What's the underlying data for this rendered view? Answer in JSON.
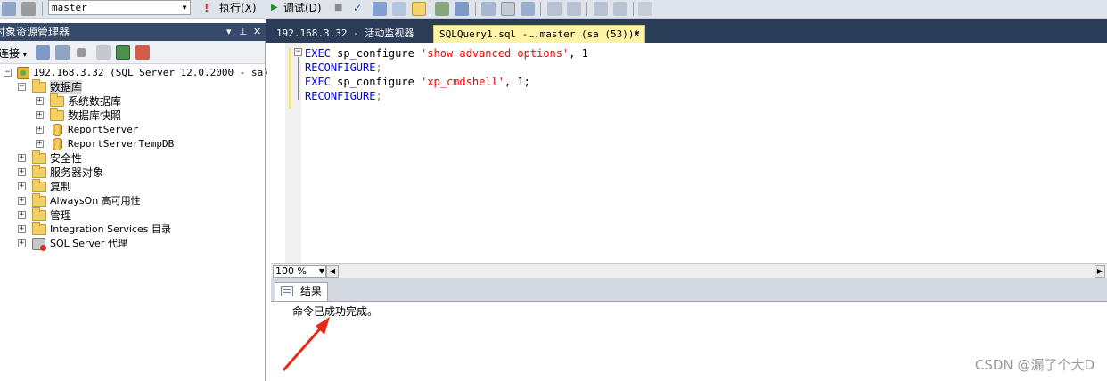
{
  "toolbar": {
    "database": "master",
    "execute_label": "执行(X)",
    "debug_label": "调试(D)"
  },
  "object_explorer": {
    "title": "对象资源管理器",
    "connect_label": "连接",
    "server": "192.168.3.32 (SQL Server 12.0.2000 - sa)",
    "databases_label": "数据库",
    "db_children": [
      "系统数据库",
      "数据库快照",
      "ReportServer",
      "ReportServerTempDB"
    ],
    "server_children": [
      "安全性",
      "服务器对象",
      "复制",
      "AlwaysOn 高可用性",
      "管理",
      "Integration Services 目录",
      "SQL Server 代理"
    ]
  },
  "tabs": [
    {
      "label": "192.168.3.32 - 活动监视器"
    },
    {
      "label": "SQLQuery1.sql -….master (sa (53))*",
      "close": "×"
    }
  ],
  "editor": {
    "lines": [
      {
        "kw": "EXEC",
        "fn": " sp_configure ",
        "str": "'show advanced options'",
        "rest": ", 1"
      },
      {
        "kw": "RECONFIGURE",
        "pun": ";"
      },
      {
        "kw": "EXEC",
        "fn": " sp_configure ",
        "str": "'xp_cmdshell'",
        "rest": ", 1;"
      },
      {
        "kw": "RECONFIGURE",
        "pun": ";"
      }
    ]
  },
  "zoom": "100 %",
  "results": {
    "tab_label": "结果",
    "message": "命令已成功完成。"
  },
  "watermark": "CSDN @漏了个大D",
  "colors": {
    "chrome": "#2b3c59",
    "active_tab": "#fff3a8",
    "keyword": "#0000ff",
    "string": "#ff0000",
    "arrow": "#e8291c"
  }
}
